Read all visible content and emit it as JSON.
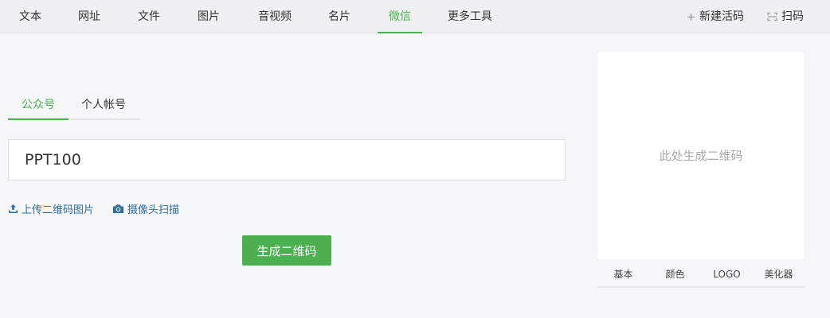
{
  "nav": {
    "tabs": [
      {
        "label": "文本"
      },
      {
        "label": "网址"
      },
      {
        "label": "文件"
      },
      {
        "label": "图片"
      },
      {
        "label": "音视频"
      },
      {
        "label": "名片"
      },
      {
        "label": "微信"
      },
      {
        "label": "更多工具"
      }
    ],
    "active_tab": "微信",
    "new_live_code": "新建活码",
    "scan": "扫码"
  },
  "subtabs": [
    {
      "label": "公众号"
    },
    {
      "label": "个人帐号"
    }
  ],
  "input": {
    "value": "PPT100"
  },
  "links": {
    "upload_qr": "上传二维码图片",
    "camera_scan": "摄像头扫描"
  },
  "generate_button": "生成二维码",
  "preview": {
    "placeholder": "此处生成二维码"
  },
  "style_tabs": [
    {
      "label": "基本"
    },
    {
      "label": "颜色"
    },
    {
      "label": "LOGO"
    },
    {
      "label": "美化器"
    }
  ],
  "colors": {
    "accent": "#4caf50",
    "link": "#2f6ea0"
  }
}
